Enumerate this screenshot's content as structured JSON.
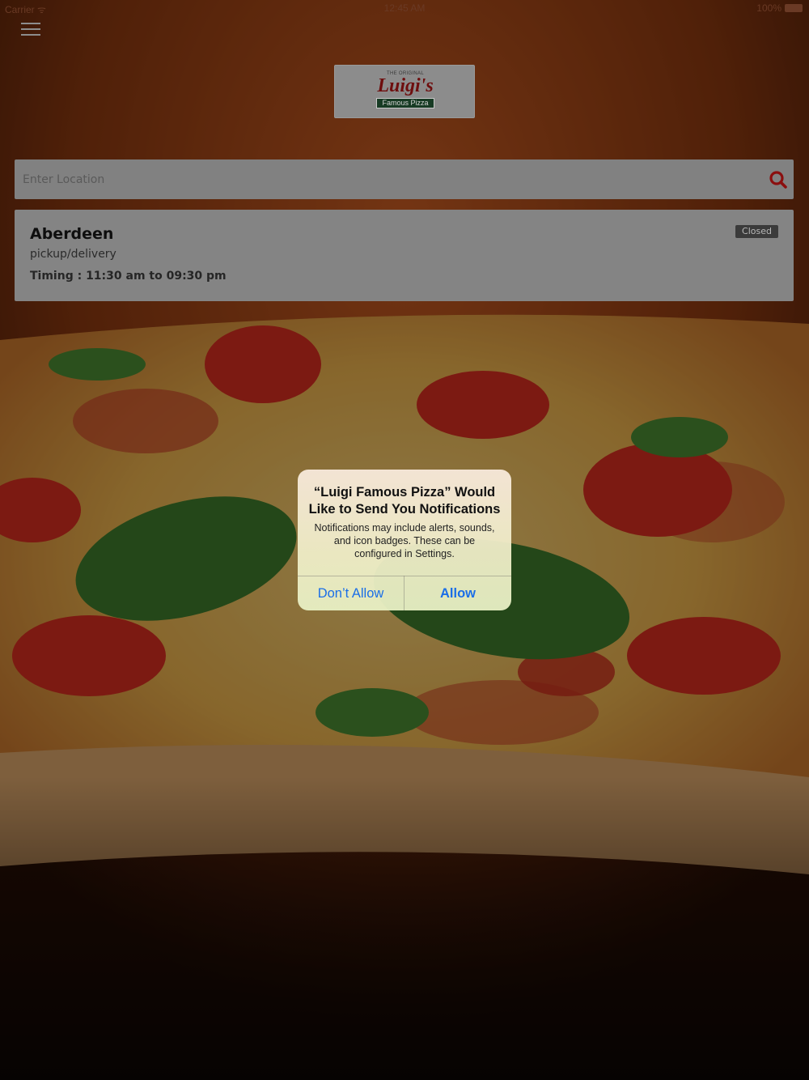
{
  "status_bar": {
    "carrier": "Carrier ᯤ",
    "time": "12:45 AM",
    "battery": "100%"
  },
  "header": {
    "menu_icon": "hamburger-menu-icon",
    "logo": {
      "small_text": "THE ORIGINAL",
      "brand": "Luigi's",
      "tagline": "Famous Pizza"
    }
  },
  "search": {
    "placeholder": "Enter Location",
    "value": "",
    "icon": "search-icon",
    "icon_color": "#8b0f0f"
  },
  "locations": [
    {
      "name": "Aberdeen",
      "service": "pickup/delivery",
      "timing": "Timing : 11:30 am to 09:30 pm",
      "status": "Closed"
    }
  ],
  "alert": {
    "title": "“Luigi Famous Pizza” Would Like to Send You Notifications",
    "message": "Notifications may include alerts, sounds, and icon badges. These can be configured in Settings.",
    "deny_label": "Don’t Allow",
    "allow_label": "Allow",
    "button_color": "#1a6ee8"
  }
}
